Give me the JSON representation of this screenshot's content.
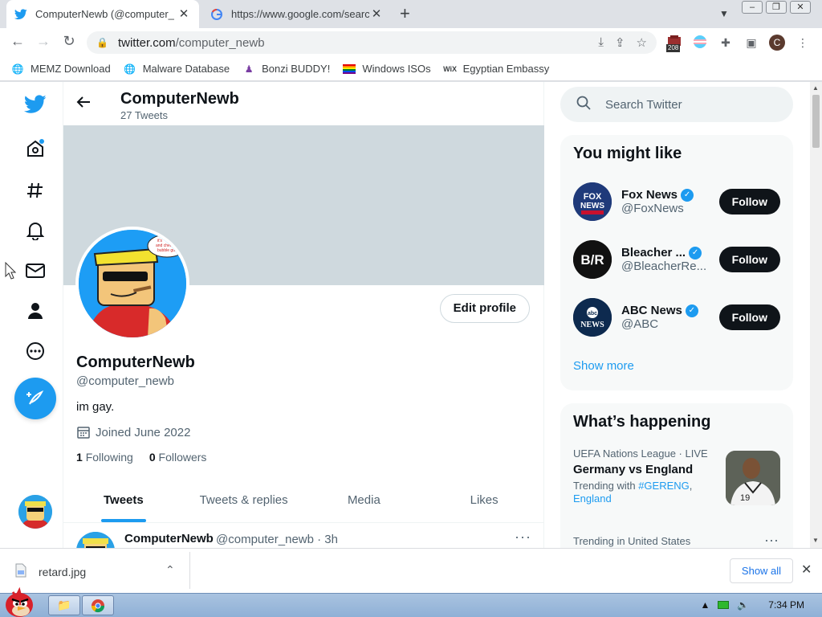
{
  "browser": {
    "tabs": [
      {
        "title": "ComputerNewb (@computer_",
        "close": "✕"
      },
      {
        "title": "https://www.google.com/search",
        "close": "✕"
      }
    ],
    "new_tab": "+",
    "url_host": "twitter.com",
    "url_path": "/computer_newb",
    "ext_badge": "208",
    "profile_initial": "C",
    "bookmarks": [
      {
        "label": "MEMZ Download"
      },
      {
        "label": "Malware Database"
      },
      {
        "label": "Bonzi BUDDY!"
      },
      {
        "label": "Windows ISOs"
      },
      {
        "label": "Egyptian Embassy"
      }
    ]
  },
  "profile_header": {
    "name": "ComputerNewb",
    "tweet_count": "27 Tweets"
  },
  "profile": {
    "edit_label": "Edit profile",
    "name": "ComputerNewb",
    "handle": "@computer_newb",
    "bio": "im gay.",
    "joined": "Joined June 2022",
    "following_count": "1",
    "following_label": "Following",
    "followers_count": "0",
    "followers_label": "Followers",
    "speech_text": "it's ... and ... bubble gu"
  },
  "tabs": [
    {
      "label": "Tweets"
    },
    {
      "label": "Tweets & replies"
    },
    {
      "label": "Media"
    },
    {
      "label": "Likes"
    }
  ],
  "tweet": {
    "name": "ComputerNewb",
    "meta": "@computer_newb · 3h"
  },
  "search": {
    "placeholder": "Search Twitter"
  },
  "you_might_like": {
    "title": "You might like",
    "accounts": [
      {
        "name": "Fox News",
        "handle": "@FoxNews",
        "follow": "Follow",
        "avatar_text": "FOX NEWS",
        "color": "#1f3a7a"
      },
      {
        "name": "Bleacher ...",
        "handle": "@BleacherRe...",
        "follow": "Follow",
        "avatar_text": "B/R",
        "color": "#111111"
      },
      {
        "name": "ABC News",
        "handle": "@ABC",
        "follow": "Follow",
        "avatar_text": "abc NEWS",
        "color": "#0d2a4f"
      }
    ],
    "show_more": "Show more"
  },
  "whats_happening": {
    "title": "What’s happening",
    "trend": {
      "context": "UEFA Nations League · LIVE",
      "title": "Germany vs England",
      "trending_with": "Trending with",
      "tag": "#GERENG",
      "tag2": "England",
      "jersey": "19"
    },
    "trend2_context": "Trending in United States"
  },
  "download": {
    "filename": "retard.jpg",
    "show_all": "Show all"
  },
  "taskbar": {
    "time": "7:34 PM"
  },
  "colors": {
    "twitter_blue": "#1d9bf0",
    "banner": "#cfd9de"
  }
}
